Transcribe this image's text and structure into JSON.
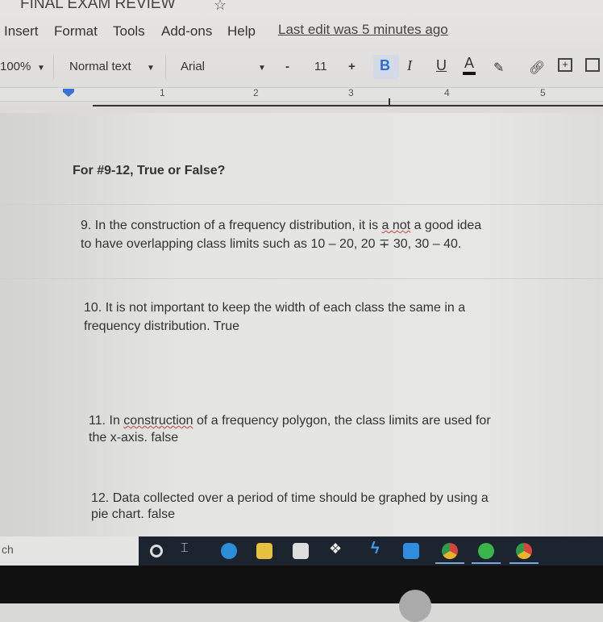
{
  "document": {
    "title": "FINAL EXAM REVIEW"
  },
  "menu": {
    "items": [
      "Insert",
      "Format",
      "Tools",
      "Add-ons",
      "Help"
    ],
    "last_edit": "Last edit was 5 minutes ago"
  },
  "toolbar": {
    "zoom": "100%",
    "style": "Normal text",
    "font": "Arial",
    "minus": "-",
    "font_size": "11",
    "plus": "+",
    "bold": "B",
    "italic": "I",
    "underline": "U",
    "text_color": "A"
  },
  "ruler": {
    "marks": [
      "1",
      "2",
      "3",
      "4",
      "5"
    ]
  },
  "content": {
    "heading": "For #9-12, True or False?",
    "q9": {
      "line1_pre": "9.  In the construction of a frequency distribution, it is ",
      "line1_err": "a not",
      "line1_post": " a good idea",
      "line2": "to have overlapping class limits such as 10 – 20, 20 ∓ 30, 30 – 40."
    },
    "q10": {
      "line1": "10.  It is not important to keep the width of each class the same in a",
      "line2": "frequency distribution. True"
    },
    "q11": {
      "line1_pre": "11.  In ",
      "line1_err": "construction",
      "line1_post": " of a frequency polygon, the class limits are used for",
      "line2": "the x-axis. false"
    },
    "q12": {
      "line1": "12.  Data collected over a period of time should be graphed by using a",
      "line2": "pie chart. false"
    }
  },
  "taskbar": {
    "search_text": "ch",
    "icons": [
      "cortana-icon",
      "task-view-icon",
      "edge-icon",
      "file-explorer-icon",
      "store-icon",
      "dropbox-icon",
      "app-icon",
      "mail-icon",
      "chrome-icon",
      "spotify-icon",
      "chrome-icon"
    ]
  }
}
